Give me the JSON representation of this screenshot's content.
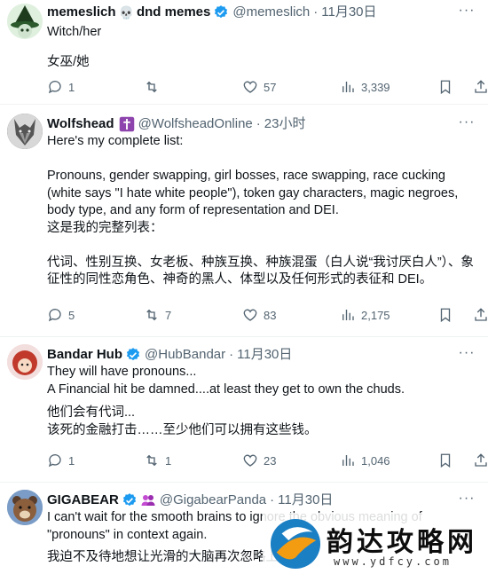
{
  "tweets": [
    {
      "display_name": "memeslich",
      "name_suffix": "dnd memes",
      "handle": "@memeslich",
      "time": "11月30日",
      "lines": [
        "Witch/her",
        "女巫/她"
      ],
      "replies": "1",
      "retweets": "",
      "likes": "57",
      "views": "3,339"
    },
    {
      "display_name": "Wolfshead",
      "handle": "@WolfsheadOnline",
      "time": "23小时",
      "lines": [
        "Here's my complete list:",
        "Pronouns, gender swapping, girl bosses, race swapping, race cucking",
        "(white says \"I hate white people\"), token gay characters, magic negroes,",
        "body type, and any form of representation and DEI.",
        "这是我的完整列表：",
        "代词、性别互换、女老板、种族互换、种族混蛋（白人说“我讨厌白人”）、象",
        "征性的同性恋角色、神奇的黑人、体型以及任何形式的表征和 DEI。"
      ],
      "replies": "5",
      "retweets": "7",
      "likes": "83",
      "views": "2,175"
    },
    {
      "display_name": "Bandar Hub",
      "handle": "@HubBandar",
      "time": "11月30日",
      "lines": [
        "They will have pronouns...",
        "A Financial hit be damned....at least they get to own the chuds.",
        "他们会有代词...",
        "该死的金融打击……至少他们可以拥有这些钱。"
      ],
      "replies": "1",
      "retweets": "1",
      "likes": "23",
      "views": "1,046"
    },
    {
      "display_name": "GIGABEAR",
      "handle": "@GigabearPanda",
      "time": "11月30日",
      "lines": [
        "I can't wait for the smooth brains to ignore the obvious meaning of",
        "\"pronouns\" in context again.",
        "我迫不及待地想让光滑的大脑再次忽略上"
      ]
    }
  ],
  "watermark": {
    "title": "韵达攻略网",
    "url": "www.ydfcy.com"
  },
  "colors": {
    "verified_blue": "#1d9bf0",
    "muted_text": "#536471",
    "cross_badge": "#8e44ad"
  }
}
